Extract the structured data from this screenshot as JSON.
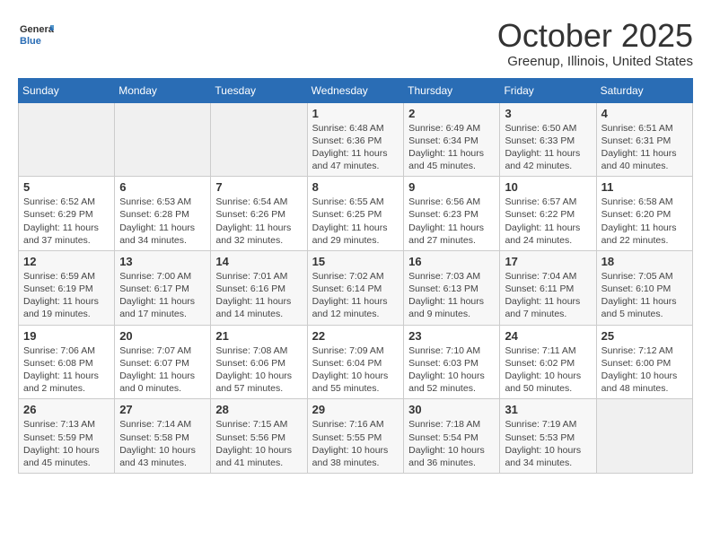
{
  "logo": {
    "general": "General",
    "blue": "Blue"
  },
  "header": {
    "title": "October 2025",
    "subtitle": "Greenup, Illinois, United States"
  },
  "weekdays": [
    "Sunday",
    "Monday",
    "Tuesday",
    "Wednesday",
    "Thursday",
    "Friday",
    "Saturday"
  ],
  "weeks": [
    [
      {
        "day": "",
        "info": ""
      },
      {
        "day": "",
        "info": ""
      },
      {
        "day": "",
        "info": ""
      },
      {
        "day": "1",
        "info": "Sunrise: 6:48 AM\nSunset: 6:36 PM\nDaylight: 11 hours and 47 minutes."
      },
      {
        "day": "2",
        "info": "Sunrise: 6:49 AM\nSunset: 6:34 PM\nDaylight: 11 hours and 45 minutes."
      },
      {
        "day": "3",
        "info": "Sunrise: 6:50 AM\nSunset: 6:33 PM\nDaylight: 11 hours and 42 minutes."
      },
      {
        "day": "4",
        "info": "Sunrise: 6:51 AM\nSunset: 6:31 PM\nDaylight: 11 hours and 40 minutes."
      }
    ],
    [
      {
        "day": "5",
        "info": "Sunrise: 6:52 AM\nSunset: 6:29 PM\nDaylight: 11 hours and 37 minutes."
      },
      {
        "day": "6",
        "info": "Sunrise: 6:53 AM\nSunset: 6:28 PM\nDaylight: 11 hours and 34 minutes."
      },
      {
        "day": "7",
        "info": "Sunrise: 6:54 AM\nSunset: 6:26 PM\nDaylight: 11 hours and 32 minutes."
      },
      {
        "day": "8",
        "info": "Sunrise: 6:55 AM\nSunset: 6:25 PM\nDaylight: 11 hours and 29 minutes."
      },
      {
        "day": "9",
        "info": "Sunrise: 6:56 AM\nSunset: 6:23 PM\nDaylight: 11 hours and 27 minutes."
      },
      {
        "day": "10",
        "info": "Sunrise: 6:57 AM\nSunset: 6:22 PM\nDaylight: 11 hours and 24 minutes."
      },
      {
        "day": "11",
        "info": "Sunrise: 6:58 AM\nSunset: 6:20 PM\nDaylight: 11 hours and 22 minutes."
      }
    ],
    [
      {
        "day": "12",
        "info": "Sunrise: 6:59 AM\nSunset: 6:19 PM\nDaylight: 11 hours and 19 minutes."
      },
      {
        "day": "13",
        "info": "Sunrise: 7:00 AM\nSunset: 6:17 PM\nDaylight: 11 hours and 17 minutes."
      },
      {
        "day": "14",
        "info": "Sunrise: 7:01 AM\nSunset: 6:16 PM\nDaylight: 11 hours and 14 minutes."
      },
      {
        "day": "15",
        "info": "Sunrise: 7:02 AM\nSunset: 6:14 PM\nDaylight: 11 hours and 12 minutes."
      },
      {
        "day": "16",
        "info": "Sunrise: 7:03 AM\nSunset: 6:13 PM\nDaylight: 11 hours and 9 minutes."
      },
      {
        "day": "17",
        "info": "Sunrise: 7:04 AM\nSunset: 6:11 PM\nDaylight: 11 hours and 7 minutes."
      },
      {
        "day": "18",
        "info": "Sunrise: 7:05 AM\nSunset: 6:10 PM\nDaylight: 11 hours and 5 minutes."
      }
    ],
    [
      {
        "day": "19",
        "info": "Sunrise: 7:06 AM\nSunset: 6:08 PM\nDaylight: 11 hours and 2 minutes."
      },
      {
        "day": "20",
        "info": "Sunrise: 7:07 AM\nSunset: 6:07 PM\nDaylight: 11 hours and 0 minutes."
      },
      {
        "day": "21",
        "info": "Sunrise: 7:08 AM\nSunset: 6:06 PM\nDaylight: 10 hours and 57 minutes."
      },
      {
        "day": "22",
        "info": "Sunrise: 7:09 AM\nSunset: 6:04 PM\nDaylight: 10 hours and 55 minutes."
      },
      {
        "day": "23",
        "info": "Sunrise: 7:10 AM\nSunset: 6:03 PM\nDaylight: 10 hours and 52 minutes."
      },
      {
        "day": "24",
        "info": "Sunrise: 7:11 AM\nSunset: 6:02 PM\nDaylight: 10 hours and 50 minutes."
      },
      {
        "day": "25",
        "info": "Sunrise: 7:12 AM\nSunset: 6:00 PM\nDaylight: 10 hours and 48 minutes."
      }
    ],
    [
      {
        "day": "26",
        "info": "Sunrise: 7:13 AM\nSunset: 5:59 PM\nDaylight: 10 hours and 45 minutes."
      },
      {
        "day": "27",
        "info": "Sunrise: 7:14 AM\nSunset: 5:58 PM\nDaylight: 10 hours and 43 minutes."
      },
      {
        "day": "28",
        "info": "Sunrise: 7:15 AM\nSunset: 5:56 PM\nDaylight: 10 hours and 41 minutes."
      },
      {
        "day": "29",
        "info": "Sunrise: 7:16 AM\nSunset: 5:55 PM\nDaylight: 10 hours and 38 minutes."
      },
      {
        "day": "30",
        "info": "Sunrise: 7:18 AM\nSunset: 5:54 PM\nDaylight: 10 hours and 36 minutes."
      },
      {
        "day": "31",
        "info": "Sunrise: 7:19 AM\nSunset: 5:53 PM\nDaylight: 10 hours and 34 minutes."
      },
      {
        "day": "",
        "info": ""
      }
    ]
  ]
}
